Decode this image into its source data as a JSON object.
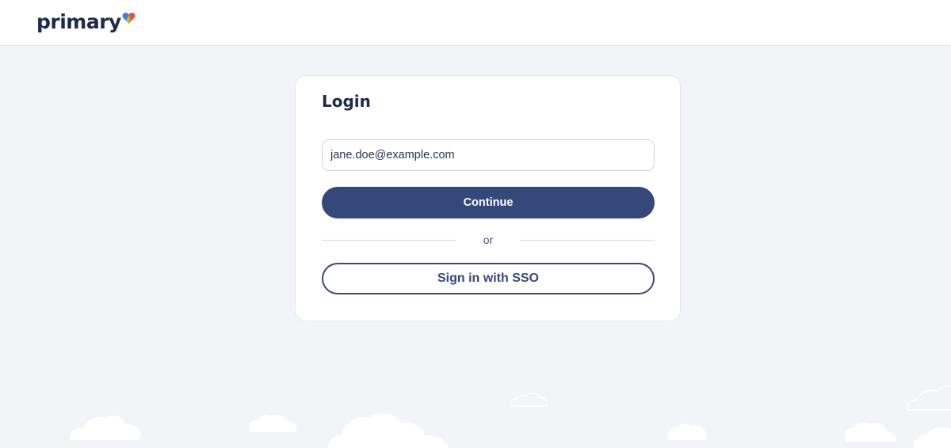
{
  "header": {
    "brand": "primary",
    "brand_heart_colors": [
      "#3b7dd8",
      "#f2b233",
      "#e94e43",
      "#7cc04b"
    ]
  },
  "login": {
    "title": "Login",
    "email_value": "jane.doe@example.com",
    "continue_label": "Continue",
    "divider_text": "or",
    "sso_label": "Sign in with SSO"
  },
  "colors": {
    "primary": "#34497a",
    "background": "#f3f4f8",
    "text": "#1d2a4a"
  }
}
